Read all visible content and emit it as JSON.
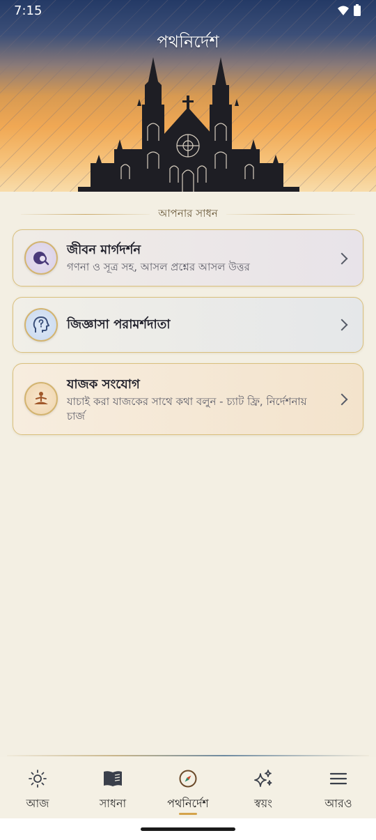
{
  "status": {
    "time": "7:15"
  },
  "header": {
    "title": "পথনির্দেশ"
  },
  "section": {
    "label": "আপনার সাধন"
  },
  "cards": [
    {
      "title": "জীবন মার্গদর্শন",
      "subtitle": "গণনা ও সূত্র সহ, আসল প্রশ্নের আসল উত্তর",
      "icon": "globe-search-icon"
    },
    {
      "title": "জিজ্ঞাসা পরামর্শদাতা",
      "subtitle": "",
      "icon": "head-question-icon"
    },
    {
      "title": "যাজক সংযোগ",
      "subtitle": "যাচাই করা যাজকের সাথে কথা বলুন - চ্যাট ফ্রি, নির্দেশনায় চার্জ",
      "icon": "meditation-icon"
    }
  ],
  "nav": [
    {
      "label": "আজ",
      "icon": "sun-icon"
    },
    {
      "label": "সাধনা",
      "icon": "book-icon"
    },
    {
      "label": "পথনির্দেশ",
      "icon": "compass-icon",
      "active": true
    },
    {
      "label": "স্বয়ং",
      "icon": "sparkles-icon"
    },
    {
      "label": "আরও",
      "icon": "menu-icon"
    }
  ],
  "colors": {
    "accent": "#d4a34a",
    "card_border": "#d9bf7c",
    "background": "#f3efe3"
  }
}
